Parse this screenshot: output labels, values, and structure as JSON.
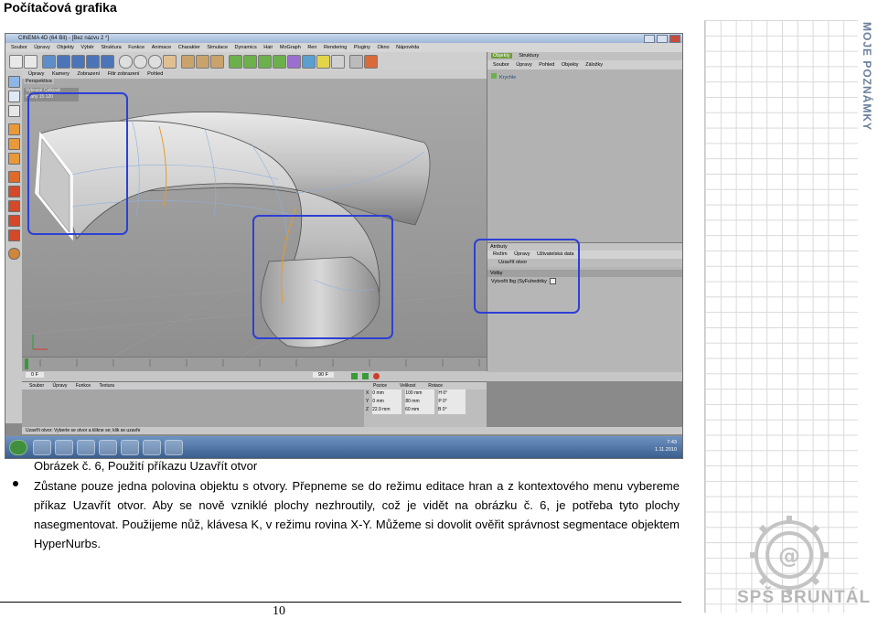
{
  "document": {
    "heading": "Počítačová grafika",
    "figure_caption": "Obrázek č. 6, Použití příkazu Uzavřít otvor",
    "paragraph": "Zůstane pouze jedna polovina objektu s otvory. Přepneme se do režimu editace hran a z kontextového menu vybereme příkaz Uzavřít otvor. Aby se nově vzniklé plochy nezhroutily, což je vidět na obrázku č. 6, je potřeba tyto plochy nasegmentovat. Použijeme nůž, klávesa K, v režimu rovina X-Y. Můžeme si dovolit ověřit správnost segmentace objektem HyperNurbs.",
    "page_number": "10"
  },
  "sidebar": {
    "title": "MOJE POZNÁMKY",
    "logo_text": "SPŠ BRUNTÁL"
  },
  "screenshot": {
    "window_title": "CINEMA 4D (64 Bit) - [Bez názvu 2 *]",
    "menu": [
      "Soubor",
      "Úpravy",
      "Objekty",
      "Výběr",
      "Struktura",
      "Funkce",
      "Animace",
      "Charakter",
      "Simulace",
      "Dynamics",
      "Hair",
      "MoGraph",
      "Ren",
      "Rendering",
      "Pluginy",
      "Okno",
      "Nápověda"
    ],
    "viewport_menu": [
      "Úpravy",
      "Kamery",
      "Zobrazení",
      "Filtr zobrazení",
      "Pohled"
    ],
    "viewport_label": "Perspektiva",
    "viewport_info": {
      "title": "Vybrané Celkově",
      "line2": "Hrany   15      120"
    },
    "panel_tabs": [
      "Objekty",
      "Struktury"
    ],
    "panel_menu": [
      "Soubor",
      "Úpravy",
      "Pohled",
      "Objekty",
      "Záložky"
    ],
    "object_name": "Krychle",
    "attributes": {
      "header": "Atributy",
      "menu": [
        "Režim",
        "Úpravy",
        "Uživatelská data"
      ],
      "tool": "Uzavřít otvor",
      "section": "Volby",
      "option": "Vytvořit lbg (SyFuhedriky"
    },
    "material_menu": [
      "Soubor",
      "Úpravy",
      "Funkce",
      "Textura"
    ],
    "coord_head": [
      "Pozice",
      "Velikost",
      "Rotace"
    ],
    "coord_rows": [
      {
        "axis": "X",
        "pos": "0 mm",
        "size": "100 mm",
        "rot": "H 0°"
      },
      {
        "axis": "Y",
        "pos": "0 mm",
        "size": "80 mm",
        "rot": "P 0°"
      },
      {
        "axis": "Z",
        "pos": "22.9 mm",
        "size": "60 mm",
        "rot": "B 0°"
      }
    ],
    "frame_left": "0 F",
    "frame_right": "90 F",
    "status": "Uzavřít otvor: Vyberte se otvor a klikne se; klik se uzavře",
    "clock": {
      "time": "7:43",
      "date": "1.11.2010"
    }
  }
}
